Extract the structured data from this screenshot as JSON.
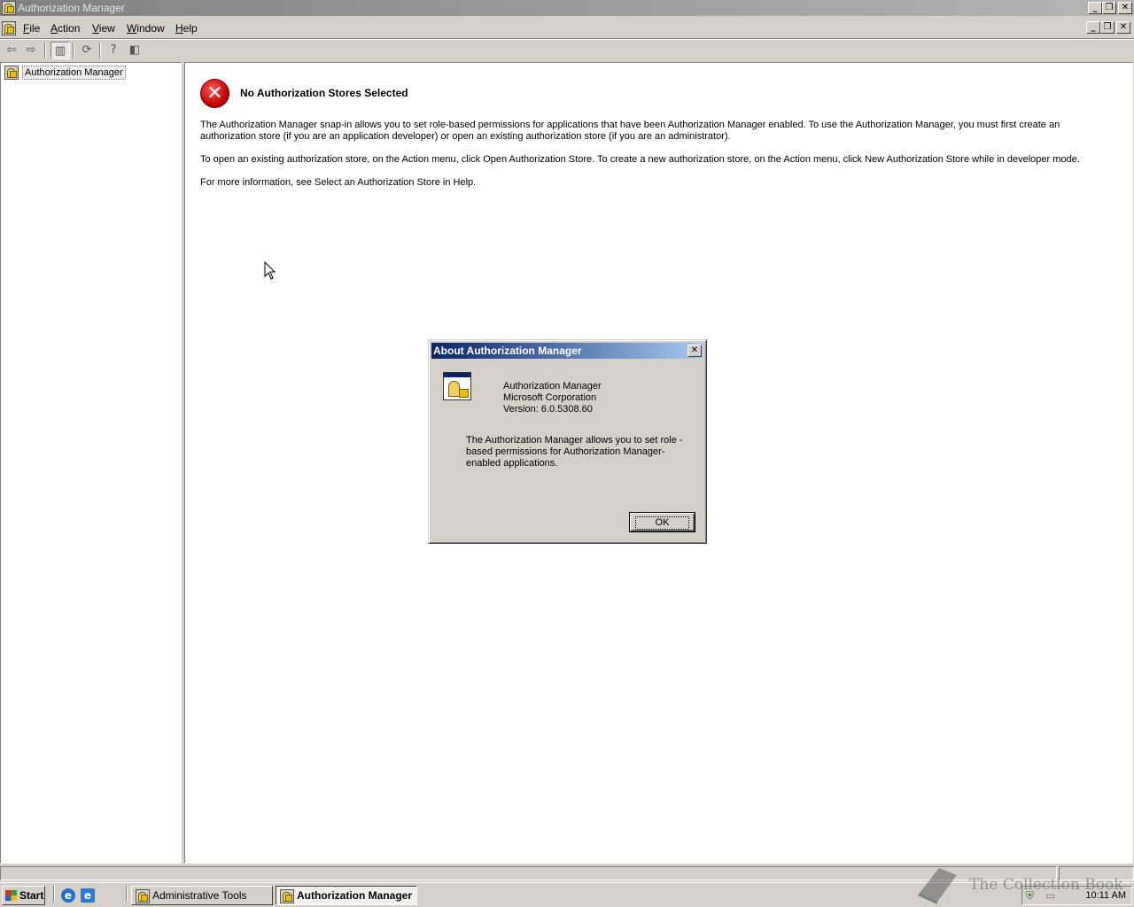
{
  "window": {
    "title": "Authorization Manager"
  },
  "menubar": {
    "items": [
      {
        "label": "File"
      },
      {
        "label": "Action"
      },
      {
        "label": "View"
      },
      {
        "label": "Window"
      },
      {
        "label": "Help"
      }
    ]
  },
  "toolbar": {
    "icons": [
      "back-icon",
      "forward-icon",
      "show-hide-tree-icon",
      "refresh-icon",
      "help-icon",
      "show-hide-action-pane-icon"
    ]
  },
  "tree": {
    "root_label": "Authorization Manager"
  },
  "result_pane": {
    "heading": "No Authorization Stores Selected",
    "paragraphs": [
      "The Authorization Manager snap-in allows you to set role-based permissions for applications that have been Authorization Manager enabled. To use the Authorization Manager, you must first create an authorization store (if you are an application developer) or open an existing authorization store (if you are an administrator).",
      "To open an existing authorization store, on the Action menu, click Open Authorization Store. To create a new authorization store, on the Action menu, click New Authorization Store while in developer mode.",
      "For more information, see Select an Authorization Store in Help."
    ]
  },
  "about_dialog": {
    "title": "About Authorization Manager",
    "product": "Authorization Manager",
    "company": "Microsoft Corporation",
    "version": "Version: 6.0.5308.60",
    "description": "The Authorization Manager allows you to set role -based permissions for Authorization Manager-enabled applications.",
    "ok_label": "OK"
  },
  "taskbar": {
    "start_label": "Start",
    "tasks": [
      {
        "label": "Administrative Tools",
        "active": false
      },
      {
        "label": "Authorization Manager",
        "active": true
      }
    ],
    "clock": "10:11 AM"
  },
  "watermark": {
    "text": "The Collection Book"
  },
  "colors": {
    "dialog_title_start": "#0a246a",
    "dialog_title_end": "#a6caf0",
    "error_red": "#c00000",
    "face": "#d4d0c8"
  }
}
